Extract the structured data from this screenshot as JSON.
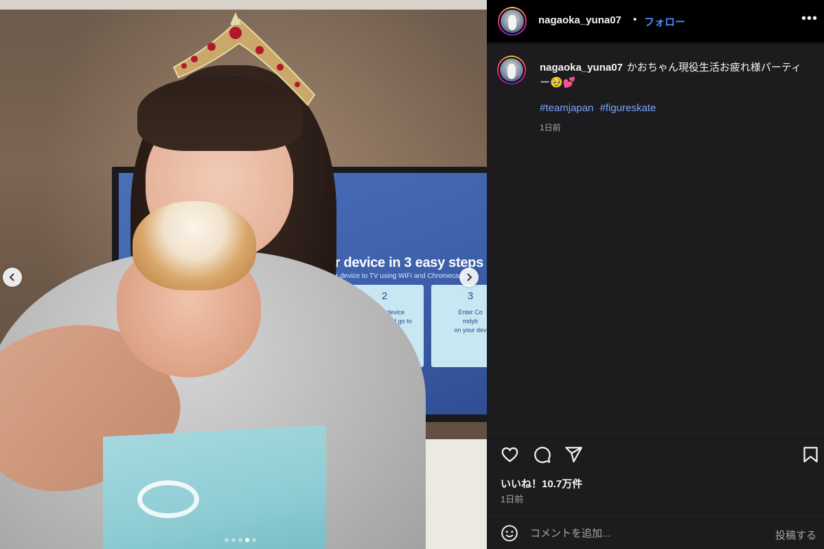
{
  "post": {
    "username": "nagaoka_yuna07",
    "separator": "•",
    "follow_label": "フォロー",
    "more_label": "•••",
    "caption": "かおちゃん現役生活お疲れ様パーティー🥹💕",
    "hashtags": [
      "#teamjapan",
      "#figureskate"
    ],
    "caption_time": "1日前",
    "likes": "いいね！10.7万件",
    "time": "1日前"
  },
  "media": {
    "photo_description_icons": [
      "chevron-left-icon",
      "chevron-right-icon"
    ],
    "tv_heading": "your device in 3 easy steps",
    "tv_subtext": "your device to TV using WiFi and Chromecast",
    "tv_cards": [
      {
        "num": "2",
        "text": "on your device\nn browser and go to\nt.com"
      },
      {
        "num": "3",
        "text": "Enter Co\nmdyb\non your dev"
      }
    ],
    "carousel": {
      "count": 5,
      "active_index": 3
    }
  },
  "actions": {
    "icons": [
      "heart-icon",
      "comment-icon",
      "share-icon",
      "bookmark-icon"
    ]
  },
  "comment_box": {
    "placeholder": "コメントを追加...",
    "post_label": "投稿する",
    "emoji_icon": "emoji-icon"
  },
  "colors": {
    "panel_bg": "#1c1c1e",
    "link_blue": "#4f8cff",
    "hashtag_blue": "#7ba4ff",
    "muted": "#a8a8a8"
  }
}
